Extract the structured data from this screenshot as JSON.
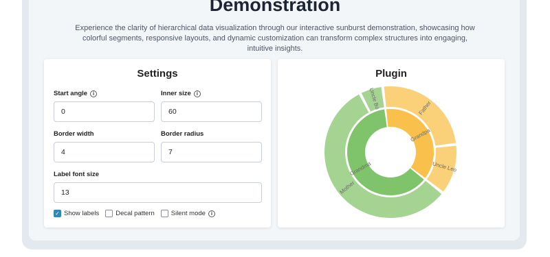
{
  "header": {
    "title": "Demonstration",
    "subtitle": "Experience the clarity of hierarchical data visualization through our interactive sunburst demonstration, showcasing how colorful segments, responsive layouts, and dynamic customization can transform complex structures into engaging, intuitive insights."
  },
  "settings": {
    "title": "Settings",
    "start_angle": {
      "label": "Start angle",
      "value": "0"
    },
    "inner_size": {
      "label": "Inner size",
      "value": "60"
    },
    "border_width": {
      "label": "Border width",
      "value": "4"
    },
    "border_radius": {
      "label": "Border radius",
      "value": "7"
    },
    "label_font_size": {
      "label": "Label font size",
      "value": "13"
    },
    "show_labels": {
      "label": "Show labels",
      "checked": true
    },
    "decal_pattern": {
      "label": "Decal pattern",
      "checked": false
    },
    "silent_mode": {
      "label": "Silent mode",
      "checked": false
    }
  },
  "plugin": {
    "title": "Plugin",
    "chart_data": {
      "type": "sunburst",
      "start_angle": 0,
      "inner_size": 60,
      "data": [
        {
          "name": "Grandpa",
          "value": 3,
          "color": "#f9c04b",
          "children": [
            {
              "name": "Father",
              "value": 2,
              "color": "#fad178"
            },
            {
              "name": "Uncle Leo",
              "value": 1,
              "color": "#fad178"
            }
          ]
        },
        {
          "name": "Grandma",
          "value": 5,
          "color": "#7fc46b",
          "children": [
            {
              "name": "Mother",
              "value": 4,
              "color": "#a5d492"
            },
            {
              "name": "Uncle Bo",
              "value": 0.4,
              "color": "#a5d492"
            }
          ]
        }
      ],
      "labels_shown": [
        "Father",
        "Uncle Leo",
        "Grandpa",
        "Grandma",
        "Uncle Bo",
        "Mother"
      ]
    }
  }
}
